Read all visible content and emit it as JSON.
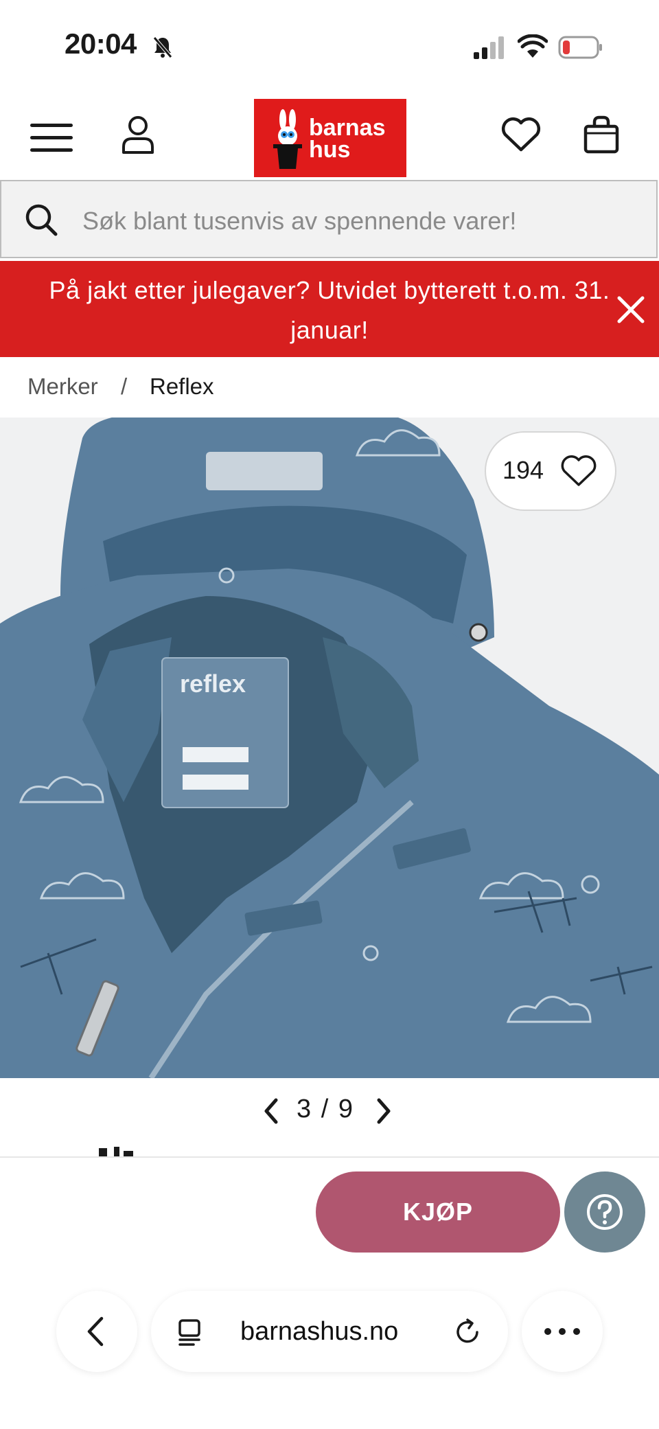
{
  "status_bar": {
    "time": "20:04",
    "battery_color": "#e23b3b"
  },
  "header": {
    "logo_line1": "barnas",
    "logo_line2": "hus",
    "brand_color": "#e01b1b"
  },
  "search": {
    "placeholder": "Søk blant tusenvis av spennende varer!"
  },
  "promo": {
    "text": "På jakt etter julegaver? Utvidet bytterett t.o.m. 31. januar!",
    "color": "#d71f1f"
  },
  "breadcrumb": {
    "items": [
      "Merker",
      "Reflex"
    ],
    "separator": "/"
  },
  "product": {
    "favorites_count": "194",
    "tag_brand": "reflex"
  },
  "gallery": {
    "current": "3",
    "separator": "/",
    "total": "9"
  },
  "actions": {
    "buy_label": "KJØP",
    "buy_color": "#b0566f",
    "help_color": "#6f8793"
  },
  "browser": {
    "url": "barnashus.no"
  }
}
